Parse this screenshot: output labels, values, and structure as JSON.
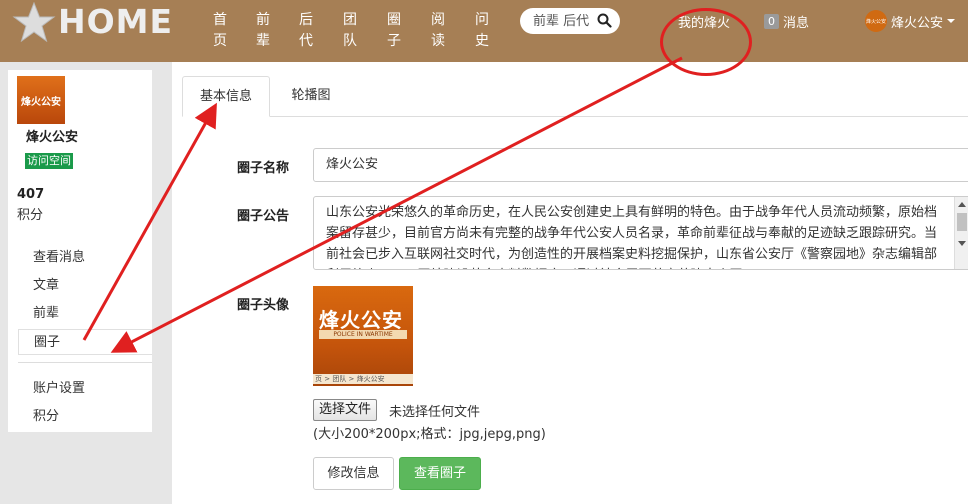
{
  "header": {
    "logo_text": "HOME",
    "nav": [
      {
        "label": "首页"
      },
      {
        "label": "前辈"
      },
      {
        "label": "后代"
      },
      {
        "label": "团队"
      },
      {
        "label": "圈子"
      },
      {
        "label": "阅读"
      },
      {
        "label": "问史"
      }
    ],
    "search_placeholder": "前辈 后代",
    "my_fire": "我的烽火",
    "msg_count": "0",
    "msg_label": "消息",
    "user_name": "烽火公安",
    "user_avatar_text": "烽火公安"
  },
  "sidebar": {
    "logo_text": "烽火公安",
    "name": "烽火公安",
    "visit_label": "访问空间",
    "score_value": "407",
    "score_label": "积分",
    "menu": [
      {
        "label": "查看消息"
      },
      {
        "label": "文章"
      },
      {
        "label": "前辈"
      },
      {
        "label": "圈子"
      },
      {
        "label": "账户设置"
      },
      {
        "label": "积分"
      }
    ]
  },
  "main": {
    "tabs": [
      {
        "label": "基本信息"
      },
      {
        "label": "轮播图"
      }
    ],
    "form": {
      "name_label": "圈子名称",
      "name_value": "烽火公安",
      "notice_label": "圈子公告",
      "notice_value": "山东公安光荣悠久的革命历史，在人民公安创建史上具有鲜明的特色。由于战争年代人员流动频繁，原始档案留存甚少，目前官方尚未有完整的战争年代公安人员名录，革命前辈征战与奉献的足迹缺乏跟踪研究。当前社会已步入互联网社交时代，为创造性的开展档案史料挖掘保护，山东省公安厅《警察园地》杂志编辑部利用烽火HOME网站建设革命史料数据库，通过社会层面共享共建大众网。",
      "avatar_label": "圈子头像",
      "avatar_title": "烽火公安",
      "avatar_subtitle": "POLICE IN WARTIME",
      "avatar_breadcrumb": "页 > 团队 > 烽火公安",
      "file_button": "选择文件",
      "file_status": "未选择任何文件",
      "hint": "(大小200*200px;格式：jpg,jepg,png)",
      "edit_button": "修改信息",
      "view_button": "查看圈子"
    }
  },
  "colors": {
    "header_bg": "#a67f55",
    "accent_green": "#5cb85c",
    "annotation_red": "#e02020"
  }
}
